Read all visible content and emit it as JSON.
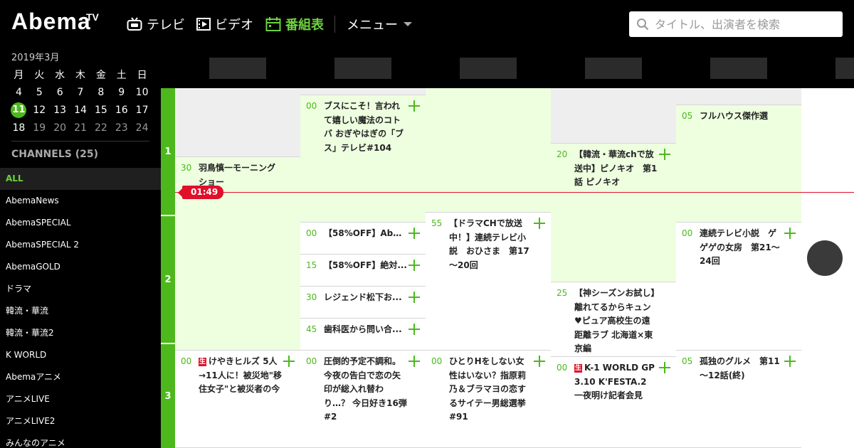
{
  "header": {
    "logo": "Abema",
    "logo_sup": "TV",
    "nav": [
      {
        "label": "テレビ",
        "icon": "tv-icon"
      },
      {
        "label": "ビデオ",
        "icon": "film-icon"
      },
      {
        "label": "番組表",
        "icon": "calendar-icon",
        "active": true
      },
      {
        "label": "メニュー",
        "icon": "chevron-down-icon"
      }
    ],
    "search_placeholder": "タイトル、出演者を検索"
  },
  "colors": {
    "accent": "#4cb81c",
    "accent_text": "#6dd23e",
    "now": "#e0102a",
    "live_bg": "#eeffe0"
  },
  "calendar": {
    "title": "2019年3月",
    "weekdays": [
      "月",
      "火",
      "水",
      "木",
      "金",
      "土",
      "日"
    ],
    "weeks": [
      [
        "4",
        "5",
        "6",
        "7",
        "8",
        "9",
        "10"
      ],
      [
        "11",
        "12",
        "13",
        "14",
        "15",
        "16",
        "17"
      ],
      [
        "18",
        "19",
        "20",
        "21",
        "22",
        "23",
        "24"
      ]
    ],
    "today": "11"
  },
  "channels": {
    "title": "CHANNELS (25)",
    "items": [
      "ALL",
      "AbemaNews",
      "AbemaSPECIAL",
      "AbemaSPECIAL 2",
      "AbemaGOLD",
      "ドラマ",
      "韓流・華流",
      "韓流・華流2",
      "K WORLD",
      "Abemaアニメ",
      "アニメLIVE",
      "アニメLIVE2",
      "みんなのアニメ"
    ]
  },
  "guide": {
    "hours": [
      "1",
      "2",
      "3"
    ],
    "now_time": "01:49",
    "columns": [
      [
        {
          "min": "",
          "title": ""
        },
        {
          "min": "30",
          "title": "羽鳥慎一モーニングショー"
        },
        {
          "min": "00",
          "title": "けやきヒルズ 5人→11人に！被災地\"移住女子\"と被災者の今",
          "live": true
        }
      ],
      [
        {
          "min": "",
          "title": ""
        },
        {
          "min": "00",
          "title": "ブスにこそ！言われて嬉しい魔法のコトバ おぎやはぎの「ブス」テレビ#104"
        },
        {
          "min": "00",
          "title": "【58%OFF】Abe..."
        },
        {
          "min": "15",
          "title": "【58%OFF】絶対..."
        },
        {
          "min": "30",
          "title": "レジェンド松下お..."
        },
        {
          "min": "45",
          "title": "歯科医から問い合..."
        },
        {
          "min": "00",
          "title": "圧倒的予定不調和。今夜の告白で恋の矢印が総入れ替わり…？ 今日好き16弾 #2"
        }
      ],
      [
        {
          "min": "",
          "title": ""
        },
        {
          "min": "55",
          "title": "【ドラマCHで放送中！】連続テレビ小説　おひさま　第17～20回"
        },
        {
          "min": "00",
          "title": "ひとりHをしない女性はいない？指原莉乃＆ブラマヨの恋するサイテー男総選挙#91"
        }
      ],
      [
        {
          "min": "",
          "title": ""
        },
        {
          "min": "20",
          "title": "【韓流・華流chで放送中】ピノキオ　第1話 ピノキオ"
        },
        {
          "min": "",
          "title": ""
        },
        {
          "min": "25",
          "title": "【神シーズンお試し】離れてるからキュン♥ピュア高校生の遠距離ラブ 北海道×東京編"
        },
        {
          "min": "00",
          "title": "K-1 WORLD GP 3.10 K'FESTA.2 一夜明け記者会見",
          "live": true
        }
      ],
      [
        {
          "min": "",
          "title": ""
        },
        {
          "min": "05",
          "title": "フルハウス傑作選"
        },
        {
          "min": "00",
          "title": "連続テレビ小説　ゲゲゲの女房　第21～24回"
        },
        {
          "min": "05",
          "title": "孤独のグルメ　第11～12話(終)"
        }
      ]
    ]
  }
}
